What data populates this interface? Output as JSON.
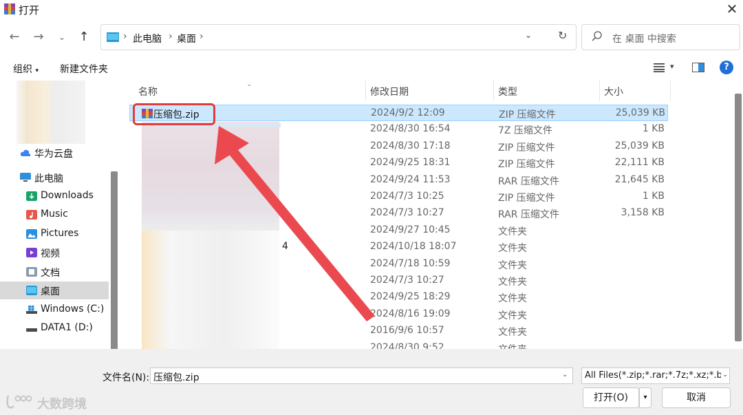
{
  "window": {
    "title": "打开",
    "close_label": "✕"
  },
  "nav_buttons": {
    "back": "←",
    "forward": "→",
    "recent": "⌄",
    "up": "↑"
  },
  "address": {
    "breadcrumbs": [
      "此电脑",
      "桌面"
    ],
    "separator": "›",
    "dropdown": "⌄",
    "refresh": "↻"
  },
  "search": {
    "placeholder": "在 桌面 中搜索"
  },
  "toolbar": {
    "organize": "组织",
    "organize_arrow": "▾",
    "new_folder": "新建文件夹",
    "view_arrow": "▾",
    "help": "?"
  },
  "nav_pane": {
    "items": [
      {
        "label": "华为云盘",
        "icon": "cloud-icon",
        "color": "#3b82f6"
      },
      {
        "label": "此电脑",
        "icon": "computer-icon",
        "color": "#2f8fdd"
      },
      {
        "label": "Downloads",
        "icon": "downloads-icon",
        "color": "#1ba36b"
      },
      {
        "label": "Music",
        "icon": "music-icon",
        "color": "#e4574a"
      },
      {
        "label": "Pictures",
        "icon": "pictures-icon",
        "color": "#2a8fe0"
      },
      {
        "label": "视频",
        "icon": "video-icon",
        "color": "#7a3fd1"
      },
      {
        "label": "文档",
        "icon": "documents-icon",
        "color": "#8d9aae"
      },
      {
        "label": "桌面",
        "icon": "desktop-icon",
        "color": "#2fa4dd"
      },
      {
        "label": "Windows (C:)",
        "icon": "drive-c-icon",
        "color": "#4a4a4a"
      },
      {
        "label": "DATA1 (D:)",
        "icon": "drive-d-icon",
        "color": "#4a4a4a"
      }
    ],
    "selected": "桌面"
  },
  "file_list": {
    "columns": [
      "名称",
      "修改日期",
      "类型",
      "大小"
    ],
    "sort_indicator": "⌄",
    "rows": [
      {
        "name": "压缩包.zip",
        "date": "2024/9/2 12:09",
        "type": "ZIP 压缩文件",
        "size": "25,039 KB"
      },
      {
        "name": "",
        "date": "2024/8/30 16:54",
        "type": "7Z 压缩文件",
        "size": "1 KB"
      },
      {
        "name": "",
        "date": "2024/8/30 17:18",
        "type": "ZIP 压缩文件",
        "size": "25,039 KB"
      },
      {
        "name": "",
        "date": "2024/9/25 18:31",
        "type": "ZIP 压缩文件",
        "size": "22,111 KB"
      },
      {
        "name": "",
        "date": "2024/9/24 11:53",
        "type": "RAR 压缩文件",
        "size": "21,645 KB"
      },
      {
        "name": "",
        "date": "2024/7/3 10:25",
        "type": "ZIP 压缩文件",
        "size": "1 KB"
      },
      {
        "name": "",
        "date": "2024/7/3 10:27",
        "type": "RAR 压缩文件",
        "size": "3,158 KB"
      },
      {
        "name": "",
        "date": "2024/9/27 10:45",
        "type": "文件夹",
        "size": ""
      },
      {
        "name": "4",
        "date": "2024/10/18 18:07",
        "type": "文件夹",
        "size": ""
      },
      {
        "name": "",
        "date": "2024/7/18 10:59",
        "type": "文件夹",
        "size": ""
      },
      {
        "name": "",
        "date": "2024/7/3 10:27",
        "type": "文件夹",
        "size": ""
      },
      {
        "name": "",
        "date": "2024/9/25 18:29",
        "type": "文件夹",
        "size": ""
      },
      {
        "name": "",
        "date": "2024/8/16 19:09",
        "type": "文件夹",
        "size": ""
      },
      {
        "name": "",
        "date": "2016/9/6 10:57",
        "type": "文件夹",
        "size": ""
      },
      {
        "name": "",
        "date": "2024/8/30 9:52",
        "type": "文件夹",
        "size": ""
      }
    ],
    "selected_index": 0
  },
  "bottom": {
    "filename_label": "文件名(N):",
    "filename_value": "压缩包.zip",
    "filter_value": "All Files(*.zip;*.rar;*.7z;*.xz;*.b:",
    "open_label": "打开(O)",
    "open_arrow": "▾",
    "cancel_label": "取消",
    "dropdown": "⌄"
  },
  "watermark": {
    "text": "大数跨境"
  },
  "colors": {
    "highlight_box": "#e23b3b",
    "arrow": "#ea4a4f",
    "selection": "#cce8ff"
  }
}
